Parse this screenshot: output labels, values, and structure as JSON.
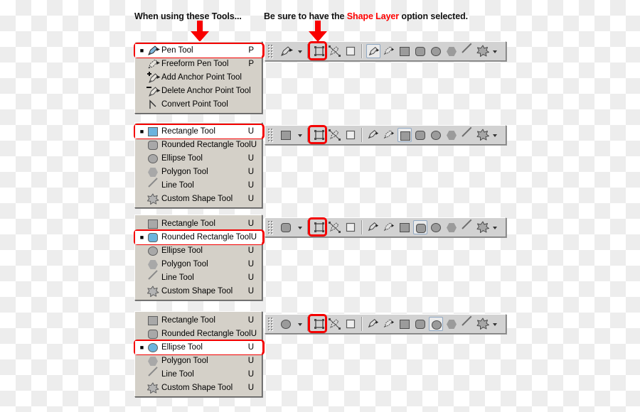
{
  "captions": {
    "left": "When using these Tools...",
    "right_pre": "Be sure to have the ",
    "right_hl": "Shape Layer",
    "right_post": " option selected."
  },
  "icons": {
    "arrow_down": "red-down-arrow",
    "gripper": "drag-gripper-icon",
    "shape_layer_mode": "shape-layer-mode-icon",
    "paths_mode": "paths-mode-icon",
    "fill_pixels_mode": "fill-pixels-mode-icon",
    "pen": "pen-tool-icon",
    "freeform_pen": "freeform-pen-tool-icon",
    "rectangle": "rectangle-shape-icon",
    "rounded_rectangle": "rounded-rectangle-shape-icon",
    "ellipse": "ellipse-shape-icon",
    "polygon": "polygon-shape-icon",
    "line": "line-shape-icon",
    "custom_shape": "custom-shape-icon",
    "caret": "chevron-down-icon"
  },
  "colors": {
    "accent_red": "#f40000",
    "panel_face": "#d4d0c8",
    "optionbar_face": "#d2d2d2",
    "selected_blue": "#6bb4de"
  },
  "panels": [
    {
      "id": "pen-flyout",
      "selected_index": 0,
      "items": [
        {
          "label": "Pen Tool",
          "key": "P",
          "icon": "pen-tool-icon"
        },
        {
          "label": "Freeform Pen Tool",
          "key": "P",
          "icon": "freeform-pen-tool-icon"
        },
        {
          "label": "Add Anchor Point Tool",
          "key": "",
          "icon": "add-anchor-point-tool-icon"
        },
        {
          "label": "Delete Anchor Point Tool",
          "key": "",
          "icon": "delete-anchor-point-tool-icon"
        },
        {
          "label": "Convert Point Tool",
          "key": "",
          "icon": "convert-point-tool-icon"
        }
      ],
      "optionbar": {
        "preview_icon": "pen-tool-icon",
        "mode_selected": "shape-layer",
        "shape_selected": "pen"
      }
    },
    {
      "id": "rectangle-flyout",
      "selected_index": 0,
      "items": [
        {
          "label": "Rectangle Tool",
          "key": "U",
          "icon": "rectangle-shape-icon"
        },
        {
          "label": "Rounded Rectangle Tool",
          "key": "U",
          "icon": "rounded-rectangle-shape-icon"
        },
        {
          "label": "Ellipse Tool",
          "key": "U",
          "icon": "ellipse-shape-icon"
        },
        {
          "label": "Polygon Tool",
          "key": "U",
          "icon": "polygon-shape-icon"
        },
        {
          "label": "Line Tool",
          "key": "U",
          "icon": "line-shape-icon"
        },
        {
          "label": "Custom Shape Tool",
          "key": "U",
          "icon": "custom-shape-icon"
        }
      ],
      "optionbar": {
        "preview_icon": "rectangle-shape-icon",
        "mode_selected": "shape-layer",
        "shape_selected": "rectangle"
      }
    },
    {
      "id": "rounded-rectangle-flyout",
      "selected_index": 1,
      "items": [
        {
          "label": "Rectangle Tool",
          "key": "U",
          "icon": "rectangle-shape-icon"
        },
        {
          "label": "Rounded Rectangle Tool",
          "key": "U",
          "icon": "rounded-rectangle-shape-icon"
        },
        {
          "label": "Ellipse Tool",
          "key": "U",
          "icon": "ellipse-shape-icon"
        },
        {
          "label": "Polygon Tool",
          "key": "U",
          "icon": "polygon-shape-icon"
        },
        {
          "label": "Line Tool",
          "key": "U",
          "icon": "line-shape-icon"
        },
        {
          "label": "Custom Shape Tool",
          "key": "U",
          "icon": "custom-shape-icon"
        }
      ],
      "optionbar": {
        "preview_icon": "rounded-rectangle-shape-icon",
        "mode_selected": "shape-layer",
        "shape_selected": "rounded-rectangle"
      }
    },
    {
      "id": "ellipse-flyout",
      "selected_index": 2,
      "items": [
        {
          "label": "Rectangle Tool",
          "key": "U",
          "icon": "rectangle-shape-icon"
        },
        {
          "label": "Rounded Rectangle Tool",
          "key": "U",
          "icon": "rounded-rectangle-shape-icon"
        },
        {
          "label": "Ellipse Tool",
          "key": "U",
          "icon": "ellipse-shape-icon"
        },
        {
          "label": "Polygon Tool",
          "key": "U",
          "icon": "polygon-shape-icon"
        },
        {
          "label": "Line Tool",
          "key": "U",
          "icon": "line-shape-icon"
        },
        {
          "label": "Custom Shape Tool",
          "key": "U",
          "icon": "custom-shape-icon"
        }
      ],
      "optionbar": {
        "preview_icon": "ellipse-shape-icon",
        "mode_selected": "shape-layer",
        "shape_selected": "ellipse"
      }
    }
  ]
}
